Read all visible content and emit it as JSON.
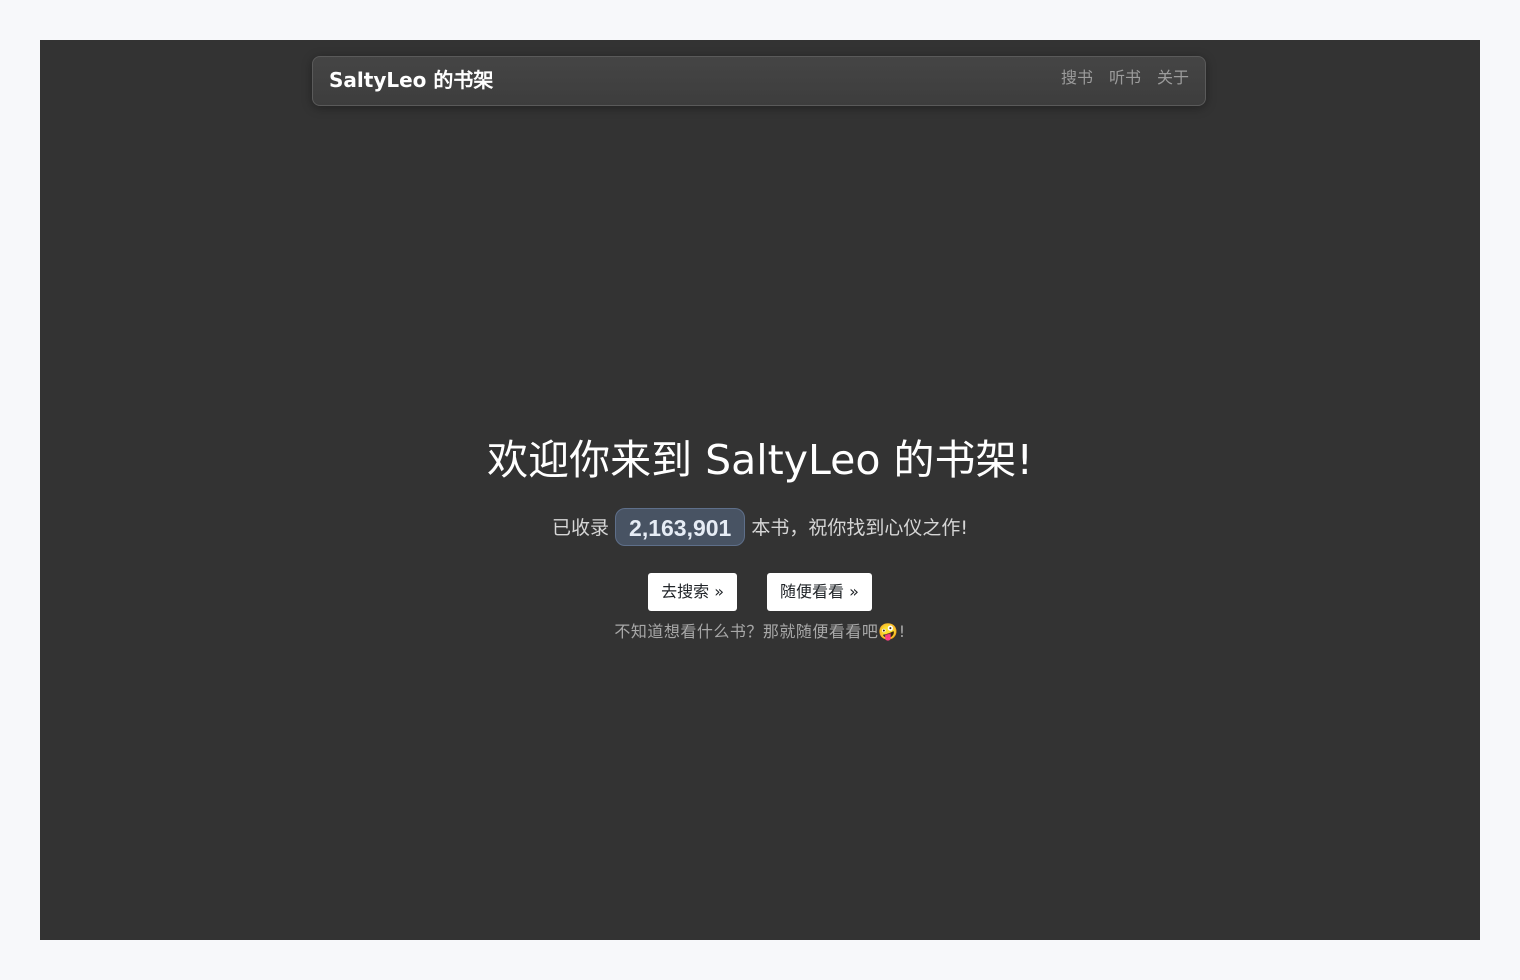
{
  "navbar": {
    "brand": "SaltyLeo 的书架",
    "links": [
      "搜书",
      "听书",
      "关于"
    ]
  },
  "hero": {
    "title": "欢迎你来到 SaltyLeo 的书架!",
    "count_prefix": "已收录",
    "book_count": "2,163,901",
    "count_suffix": "本书，祝你找到心仪之作!",
    "search_button": "去搜索 »",
    "random_button": "随便看看 »",
    "hint": "不知道想看什么书？那就随便看看吧🤪!"
  }
}
